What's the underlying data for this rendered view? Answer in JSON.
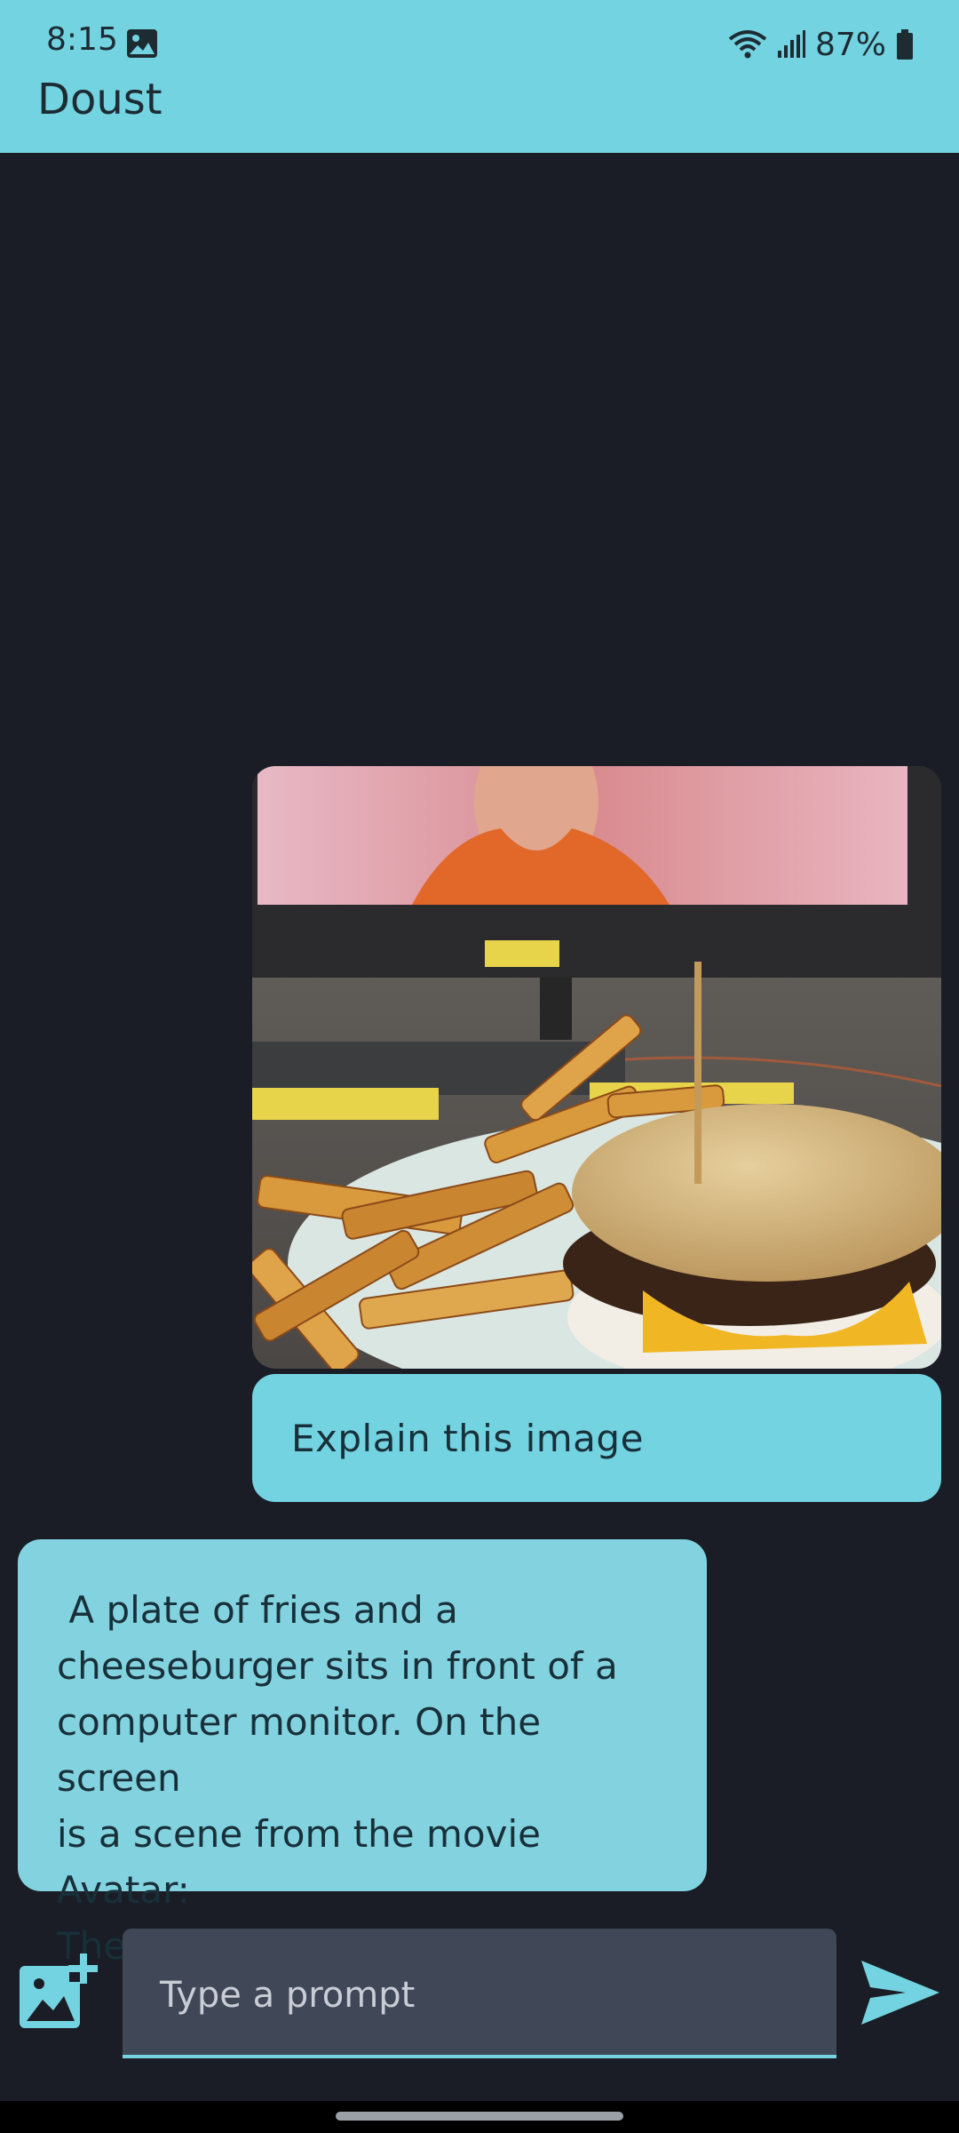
{
  "status_bar": {
    "time": "8:15",
    "battery": "87%"
  },
  "app": {
    "title": "Doust"
  },
  "chat": {
    "user_message": "Explain this image",
    "bot_message": " A plate of fries and a\ncheeseburger sits in front of a\ncomputer monitor. On the screen\nis a scene from the movie Avatar:\nThe Last Airbender."
  },
  "composer": {
    "placeholder": "Type a prompt"
  },
  "colors": {
    "accent": "#74d3e1",
    "background": "#1a1d25",
    "input": "#404757"
  },
  "icons": [
    "image-icon",
    "wifi-icon",
    "signal-icon",
    "battery-icon",
    "add-image-icon",
    "send-icon"
  ]
}
